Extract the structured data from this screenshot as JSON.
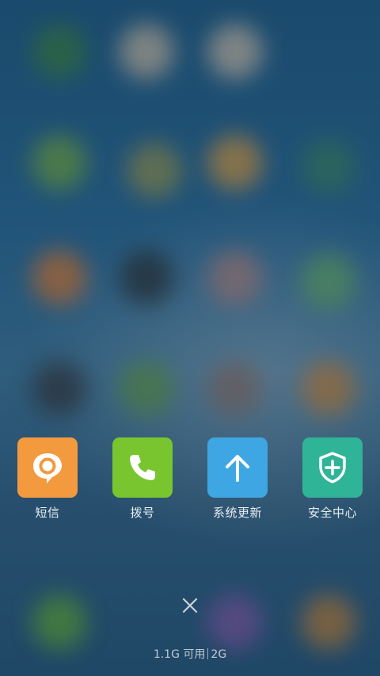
{
  "recent_apps": [
    {
      "label": "短信",
      "icon": "message-bubble-icon",
      "color": "#f39a3e"
    },
    {
      "label": "拨号",
      "icon": "phone-icon",
      "color": "#79c52f"
    },
    {
      "label": "系统更新",
      "icon": "arrow-up-icon",
      "color": "#3ea6e2"
    },
    {
      "label": "安全中心",
      "icon": "shield-plus-icon",
      "color": "#2fb497"
    }
  ],
  "close_icon": "close-icon",
  "memory": {
    "available": "1.1G 可用",
    "total": "2G"
  }
}
